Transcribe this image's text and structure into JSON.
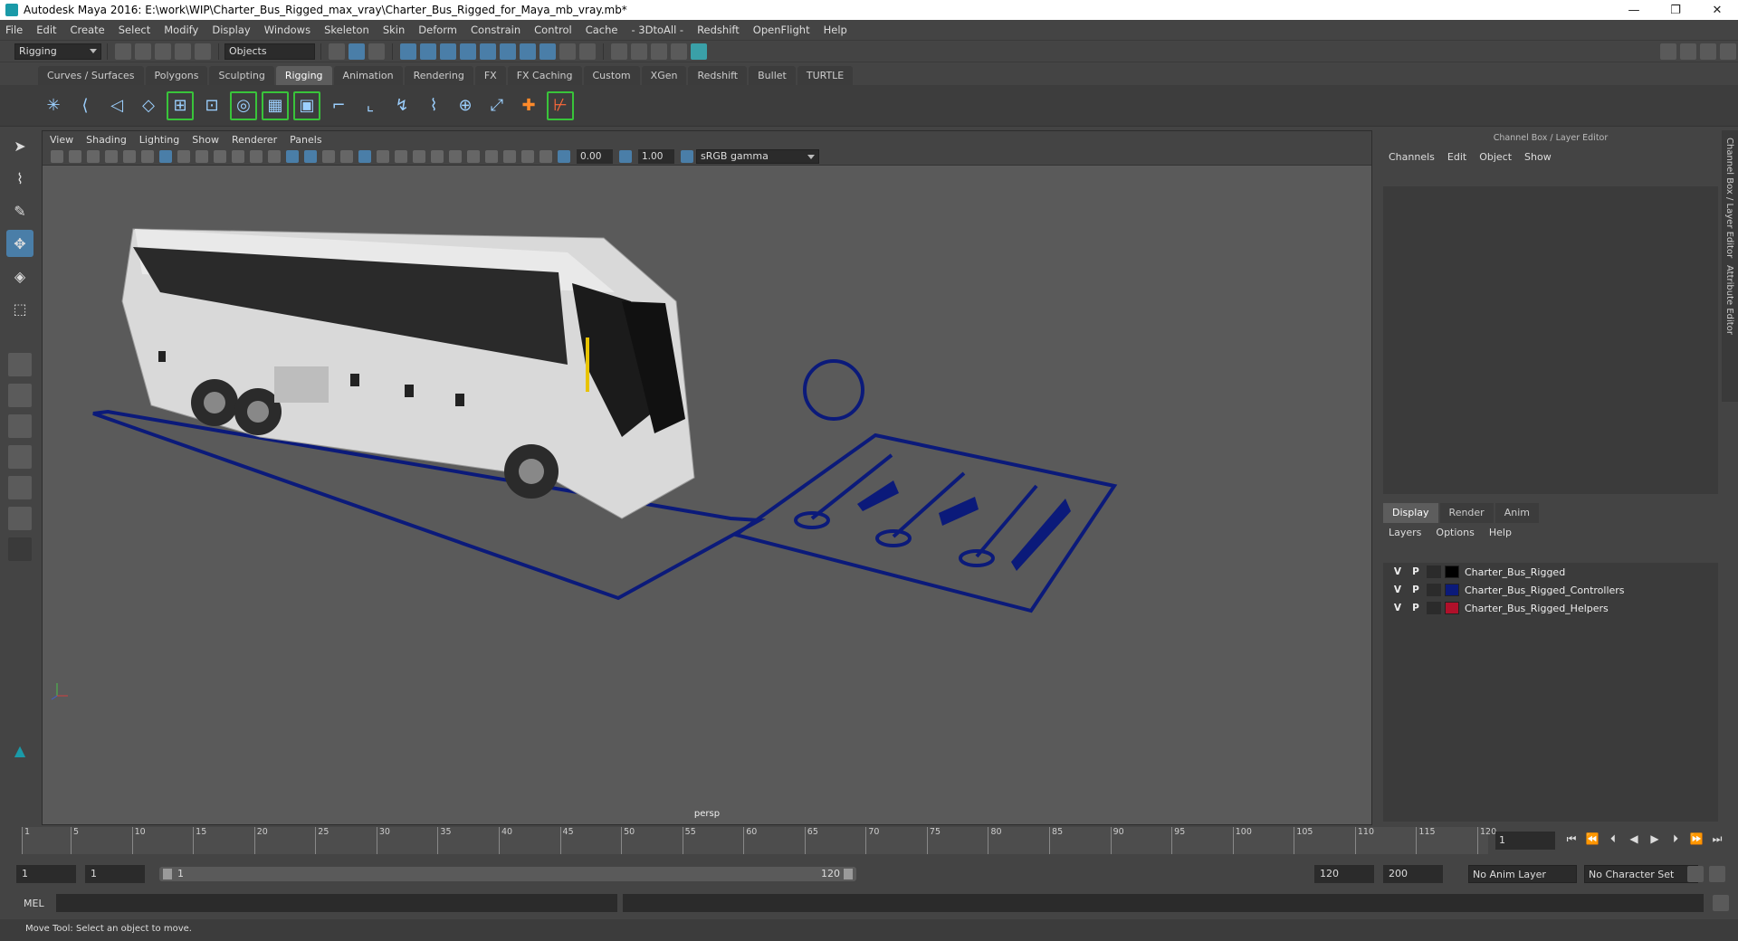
{
  "window": {
    "title": "Autodesk Maya 2016: E:\\work\\WIP\\Charter_Bus_Rigged_max_vray\\Charter_Bus_Rigged_for_Maya_mb_vray.mb*",
    "minimize": "—",
    "maximize": "❐",
    "close": "✕"
  },
  "menubar": [
    "File",
    "Edit",
    "Create",
    "Select",
    "Modify",
    "Display",
    "Windows",
    "Skeleton",
    "Skin",
    "Deform",
    "Constrain",
    "Control",
    "Cache",
    "- 3DtoAll -",
    "Redshift",
    "OpenFlight",
    "Help"
  ],
  "statusline": {
    "menuset": "Rigging",
    "selection_mode": "Objects"
  },
  "shelf": {
    "tabs": [
      "Curves / Surfaces",
      "Polygons",
      "Sculpting",
      "Rigging",
      "Animation",
      "Rendering",
      "FX",
      "FX Caching",
      "Custom",
      "XGen",
      "Redshift",
      "Bullet",
      "TURTLE"
    ],
    "active_tab": "Rigging"
  },
  "viewport": {
    "menu": [
      "View",
      "Shading",
      "Lighting",
      "Show",
      "Renderer",
      "Panels"
    ],
    "exposure": "0.00",
    "gamma": "1.00",
    "color_space": "sRGB gamma",
    "camera": "persp"
  },
  "channel_box": {
    "title": "Channel Box / Layer Editor",
    "menu": [
      "Channels",
      "Edit",
      "Object",
      "Show"
    ]
  },
  "layer_editor": {
    "tabs": [
      "Display",
      "Render",
      "Anim"
    ],
    "active_tab": "Display",
    "menu": [
      "Layers",
      "Options",
      "Help"
    ],
    "layers": [
      {
        "v": "V",
        "p": "P",
        "name": "Charter_Bus_Rigged",
        "color": "#000000"
      },
      {
        "v": "V",
        "p": "P",
        "name": "Charter_Bus_Rigged_Controllers",
        "color": "#0b1a7a"
      },
      {
        "v": "V",
        "p": "P",
        "name": "Charter_Bus_Rigged_Helpers",
        "color": "#b0102a"
      }
    ]
  },
  "side_tabs": [
    "Channel Box / Layer Editor",
    "Attribute Editor"
  ],
  "timeline": {
    "ticks": [
      1,
      5,
      10,
      15,
      20,
      25,
      30,
      35,
      40,
      45,
      50,
      55,
      60,
      65,
      70,
      75,
      80,
      85,
      90,
      95,
      100,
      105,
      110,
      115,
      120
    ],
    "current_frame": "1"
  },
  "range": {
    "start": "1",
    "playback_start": "1",
    "bar_start": "1",
    "bar_end": "120",
    "playback_end": "120",
    "end": "200",
    "anim_layer": "No Anim Layer",
    "character_set": "No Character Set"
  },
  "command_line": {
    "label": "MEL"
  },
  "help_line": {
    "text": "Move Tool: Select an object to move."
  },
  "colors": {
    "controller": "#0b1a7a",
    "accent": "#4a7ea8",
    "maya_teal": "#1a9aa8"
  }
}
